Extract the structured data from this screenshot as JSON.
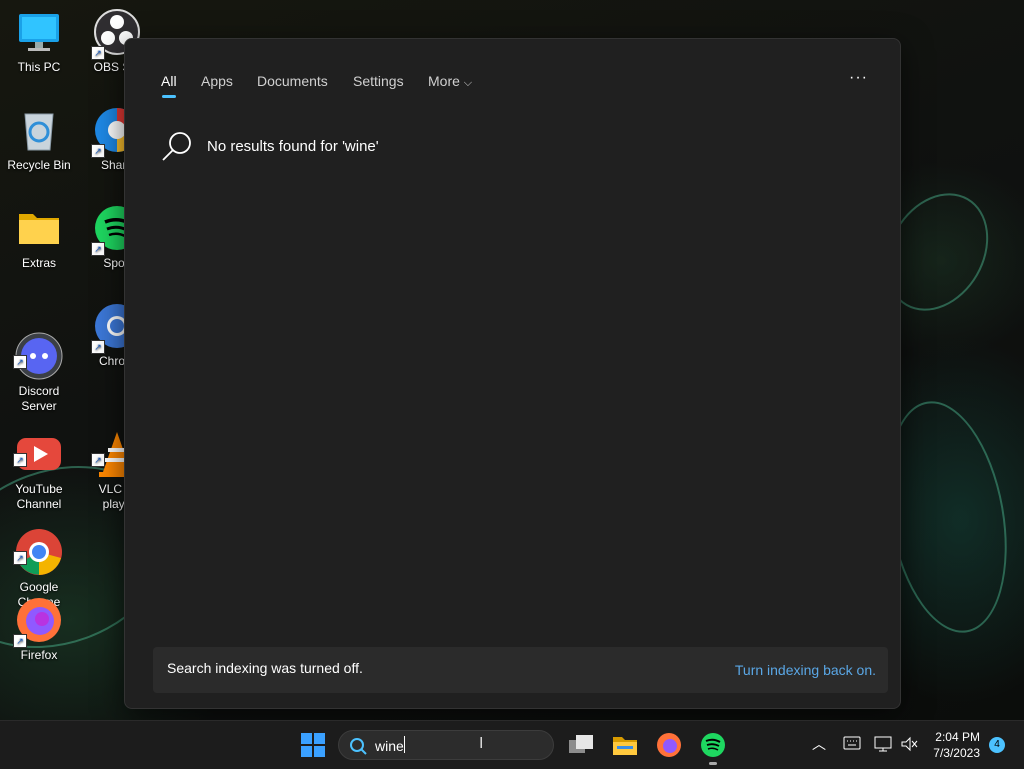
{
  "desktop": {
    "icons": [
      {
        "label": "This PC",
        "icon": "computer-icon"
      },
      {
        "label": "OBS Stu",
        "icon": "obs-icon"
      },
      {
        "label": "Recycle Bin",
        "icon": "recycle-bin-icon"
      },
      {
        "label": "Share",
        "icon": "share-icon"
      },
      {
        "label": "Extras",
        "icon": "folder-icon"
      },
      {
        "label": "Spoti",
        "icon": "spotify-icon"
      },
      {
        "label": "Discord\nServer",
        "icon": "discord-icon"
      },
      {
        "label": "Chrom",
        "icon": "chromium-icon"
      },
      {
        "label": "YouTube\nChannel",
        "icon": "youtube-icon"
      },
      {
        "label": "VLC m\nplaye",
        "icon": "vlc-icon"
      },
      {
        "label": "Google\nChrome",
        "icon": "chrome-icon"
      },
      {
        "label": "Firefox",
        "icon": "firefox-icon"
      }
    ]
  },
  "search_panel": {
    "tabs": [
      {
        "label": "All",
        "active": true
      },
      {
        "label": "Apps"
      },
      {
        "label": "Documents"
      },
      {
        "label": "Settings"
      },
      {
        "label": "More"
      }
    ],
    "more_chevron": "⌵",
    "options_label": "···",
    "no_results": "No results found for 'wine'",
    "index_message": "Search indexing was turned off.",
    "index_link": "Turn indexing back on."
  },
  "taskbar": {
    "search_value": "wine",
    "clock_time": "2:04 PM",
    "clock_date": "7/3/2023",
    "notification_count": "4"
  },
  "colors": {
    "accent": "#4cc2ff",
    "link": "#5aa7e6",
    "panel_bg": "#202020",
    "taskbar_bg": "#1c1c1c"
  }
}
